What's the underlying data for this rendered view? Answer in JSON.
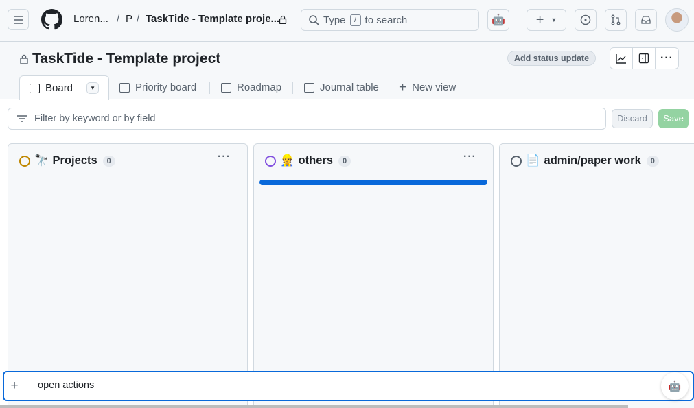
{
  "header": {
    "breadcrumb": [
      "Loren...",
      "P",
      "TaskTide - Template proje..."
    ],
    "search_prefix": "Type",
    "search_key": "/",
    "search_suffix": "to search"
  },
  "project": {
    "title": "TaskTide - Template project",
    "status_button": "Add status update"
  },
  "tabs": [
    {
      "label": "Board",
      "icon": "board-icon"
    },
    {
      "label": "Priority board",
      "icon": "board-icon"
    },
    {
      "label": "Roadmap",
      "icon": "roadmap-icon"
    },
    {
      "label": "Journal table",
      "icon": "table-icon"
    },
    {
      "label": "New view",
      "icon": "plus-icon"
    }
  ],
  "filter": {
    "placeholder": "Filter by keyword or by field",
    "discard": "Discard",
    "save": "Save"
  },
  "columns": [
    {
      "emoji": "🔭",
      "name": "Projects",
      "count": "0",
      "color": "#bf8700"
    },
    {
      "emoji": "👷",
      "name": "others",
      "count": "0",
      "color": "#8250df"
    },
    {
      "emoji": "📄",
      "name": "admin/paper work",
      "count": "0",
      "color": "#59636e"
    }
  ],
  "composer": {
    "value": "open actions"
  },
  "colors": {
    "accent": "#0969da",
    "save": "#94d3a2"
  }
}
